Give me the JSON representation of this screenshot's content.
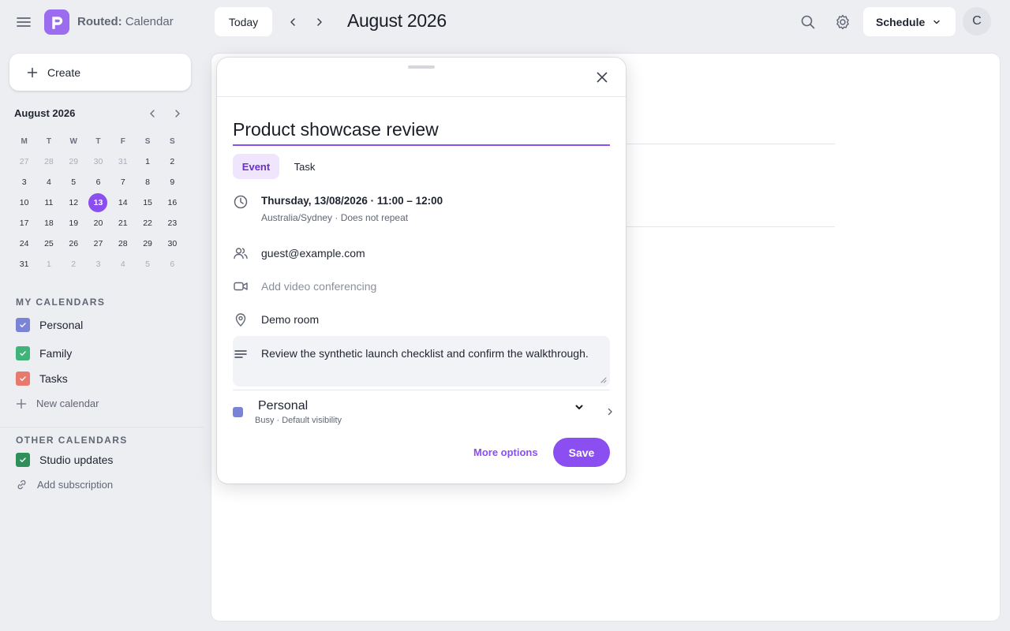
{
  "app": {
    "name_bold": "Routed:",
    "name_rest": " Calendar"
  },
  "toolbar": {
    "today_label": "Today",
    "month_title": "August 2026",
    "view_label": "Schedule",
    "avatar_initial": "C"
  },
  "sidebar": {
    "create_label": "Create",
    "mini_calendar": {
      "title": "August 2026",
      "weekdays": [
        "M",
        "T",
        "W",
        "T",
        "F",
        "S",
        "S"
      ],
      "weeks": [
        [
          "27",
          "28",
          "29",
          "30",
          "31",
          "1",
          "2"
        ],
        [
          "3",
          "4",
          "5",
          "6",
          "7",
          "8",
          "9"
        ],
        [
          "10",
          "11",
          "12",
          "13",
          "14",
          "15",
          "16"
        ],
        [
          "17",
          "18",
          "19",
          "20",
          "21",
          "22",
          "23"
        ],
        [
          "24",
          "25",
          "26",
          "27",
          "28",
          "29",
          "30"
        ],
        [
          "31",
          "1",
          "2",
          "3",
          "4",
          "5",
          "6"
        ]
      ],
      "selected_day": "13"
    },
    "my_calendars_label": "MY CALENDARS",
    "my_calendars": [
      {
        "name": "Personal",
        "color": "#7b83d6"
      },
      {
        "name": "Family",
        "color": "#3fb37a"
      },
      {
        "name": "Tasks",
        "color": "#e8796d"
      }
    ],
    "new_calendar_label": "New calendar",
    "other_calendars_label": "OTHER CALENDARS",
    "other_calendars": [
      {
        "name": "Studio updates",
        "color": "#2f8f5b"
      }
    ],
    "add_subscription_label": "Add subscription"
  },
  "event_dialog": {
    "title_value": "Product showcase review",
    "tabs": {
      "event": "Event",
      "task": "Task"
    },
    "datetime": "Thursday, 13/08/2026 · 11:00 – 12:00",
    "timezone_repeat": "Australia/Sydney · Does not repeat",
    "guest": "guest@example.com",
    "video_placeholder": "Add video conferencing",
    "location": "Demo room",
    "description": "Review the synthetic launch checklist and confirm the walkthrough.",
    "calendar": {
      "name": "Personal",
      "details": "Busy · Default visibility",
      "color": "#7b83d6"
    },
    "more_options_label": "More options",
    "save_label": "Save"
  },
  "colors": {
    "accent": "#8b4ef0",
    "logo": "#9b6cf0"
  }
}
